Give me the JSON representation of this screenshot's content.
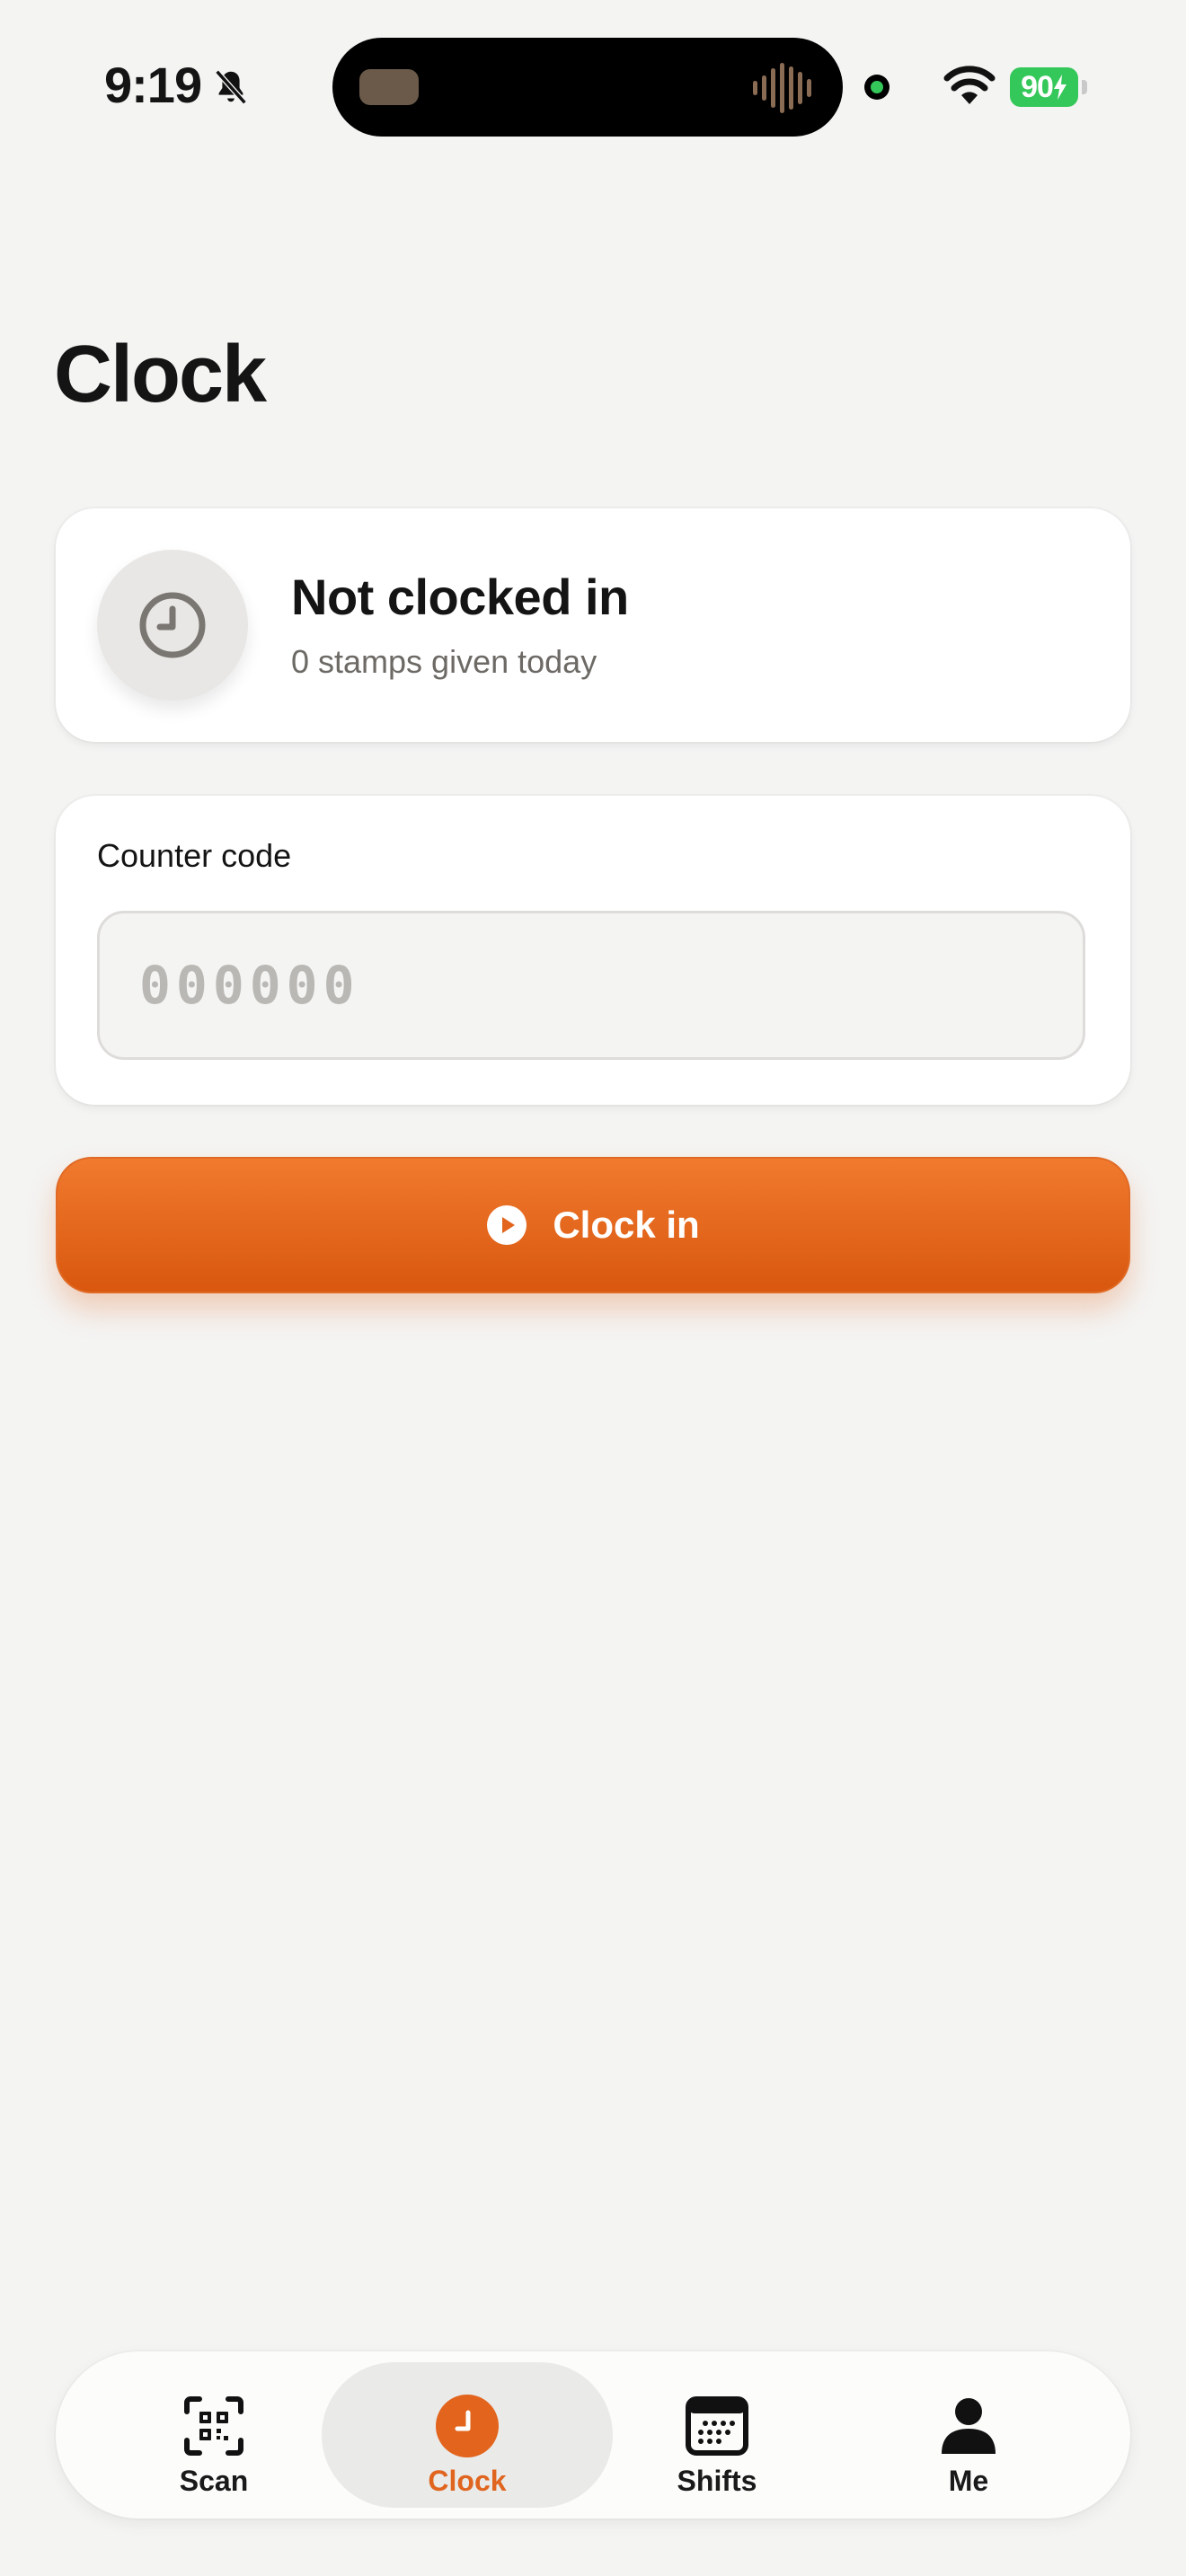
{
  "status_bar": {
    "time": "9:19",
    "battery": "90"
  },
  "header": {
    "title": "Clock"
  },
  "status_card": {
    "title": "Not clocked in",
    "subtitle": "0 stamps given today"
  },
  "counter_code": {
    "label": "Counter code",
    "placeholder": "000000",
    "value": ""
  },
  "clock_in_button": {
    "label": "Clock in"
  },
  "tab_bar": {
    "items": [
      {
        "label": "Scan",
        "icon": "qr-scan-icon",
        "active": false
      },
      {
        "label": "Clock",
        "icon": "clock-icon",
        "active": true
      },
      {
        "label": "Shifts",
        "icon": "calendar-icon",
        "active": false
      },
      {
        "label": "Me",
        "icon": "person-icon",
        "active": false
      }
    ]
  },
  "colors": {
    "accent": "#E8621A",
    "background": "#F4F4F3",
    "card": "#FFFFFF",
    "muted_text": "#6D6A66",
    "battery": "#34C759"
  }
}
